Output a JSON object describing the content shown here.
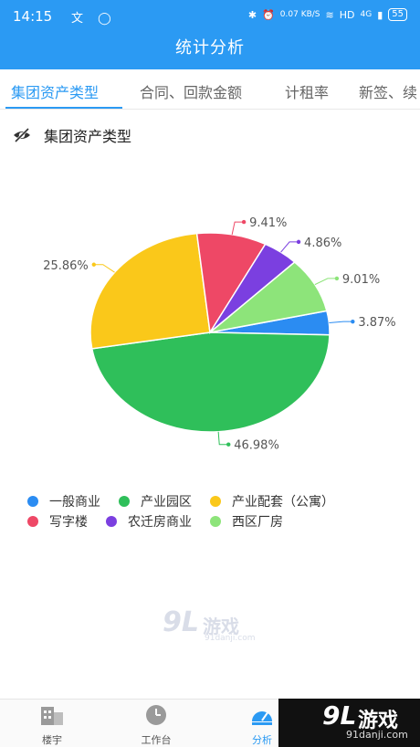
{
  "status_bar": {
    "time": "14:15",
    "left_icons": "文 ◯",
    "speed": "0.07 KB/S",
    "hd": "HD",
    "signal": "4G",
    "battery": "55"
  },
  "header": {
    "title": "统计分析"
  },
  "tabs": [
    {
      "label": "集团资产类型",
      "active": true
    },
    {
      "label": "合同、回款金额",
      "active": false
    },
    {
      "label": "计租率",
      "active": false
    },
    {
      "label": "新签、续",
      "active": false
    }
  ],
  "section": {
    "title": "集团资产类型",
    "icon": "eye-slash-icon"
  },
  "chart_data": {
    "type": "pie",
    "slices": [
      {
        "name": "一般商业",
        "value": 3.87,
        "label": "3.87%",
        "color": "#2b8cf2"
      },
      {
        "name": "产业园区",
        "value": 46.98,
        "label": "46.98%",
        "color": "#2fbf5a"
      },
      {
        "name": "产业配套（公寓）",
        "value": 25.86,
        "label": "25.86%",
        "color": "#fac81a"
      },
      {
        "name": "写字楼",
        "value": 9.41,
        "label": "9.41%",
        "color": "#ee4866"
      },
      {
        "name": "农迁房商业",
        "value": 4.86,
        "label": "4.86%",
        "color": "#7b3fe0"
      },
      {
        "name": "西区厂房",
        "value": 9.01,
        "label": "9.01%",
        "color": "#8de47a"
      }
    ],
    "legend_position": "bottom"
  },
  "legend": [
    {
      "label": "一般商业",
      "color": "#2b8cf2"
    },
    {
      "label": "产业园区",
      "color": "#2fbf5a"
    },
    {
      "label": "产业配套（公寓）",
      "color": "#fac81a"
    },
    {
      "label": "写字楼",
      "color": "#ee4866"
    },
    {
      "label": "农迁房商业",
      "color": "#7b3fe0"
    },
    {
      "label": "西区厂房",
      "color": "#8de47a"
    }
  ],
  "watermark_center": {
    "brand_num": "9L",
    "brand_text": "游戏",
    "url": "91danji.com"
  },
  "bottom_nav": [
    {
      "label": "楼宇",
      "icon": "building-icon",
      "active": false
    },
    {
      "label": "工作台",
      "icon": "clock-icon",
      "active": false
    },
    {
      "label": "分析",
      "icon": "analysis-icon",
      "active": true
    }
  ],
  "watermark_badge": {
    "brand_num": "9L",
    "brand_text": "游戏",
    "url": "91danji.com"
  }
}
